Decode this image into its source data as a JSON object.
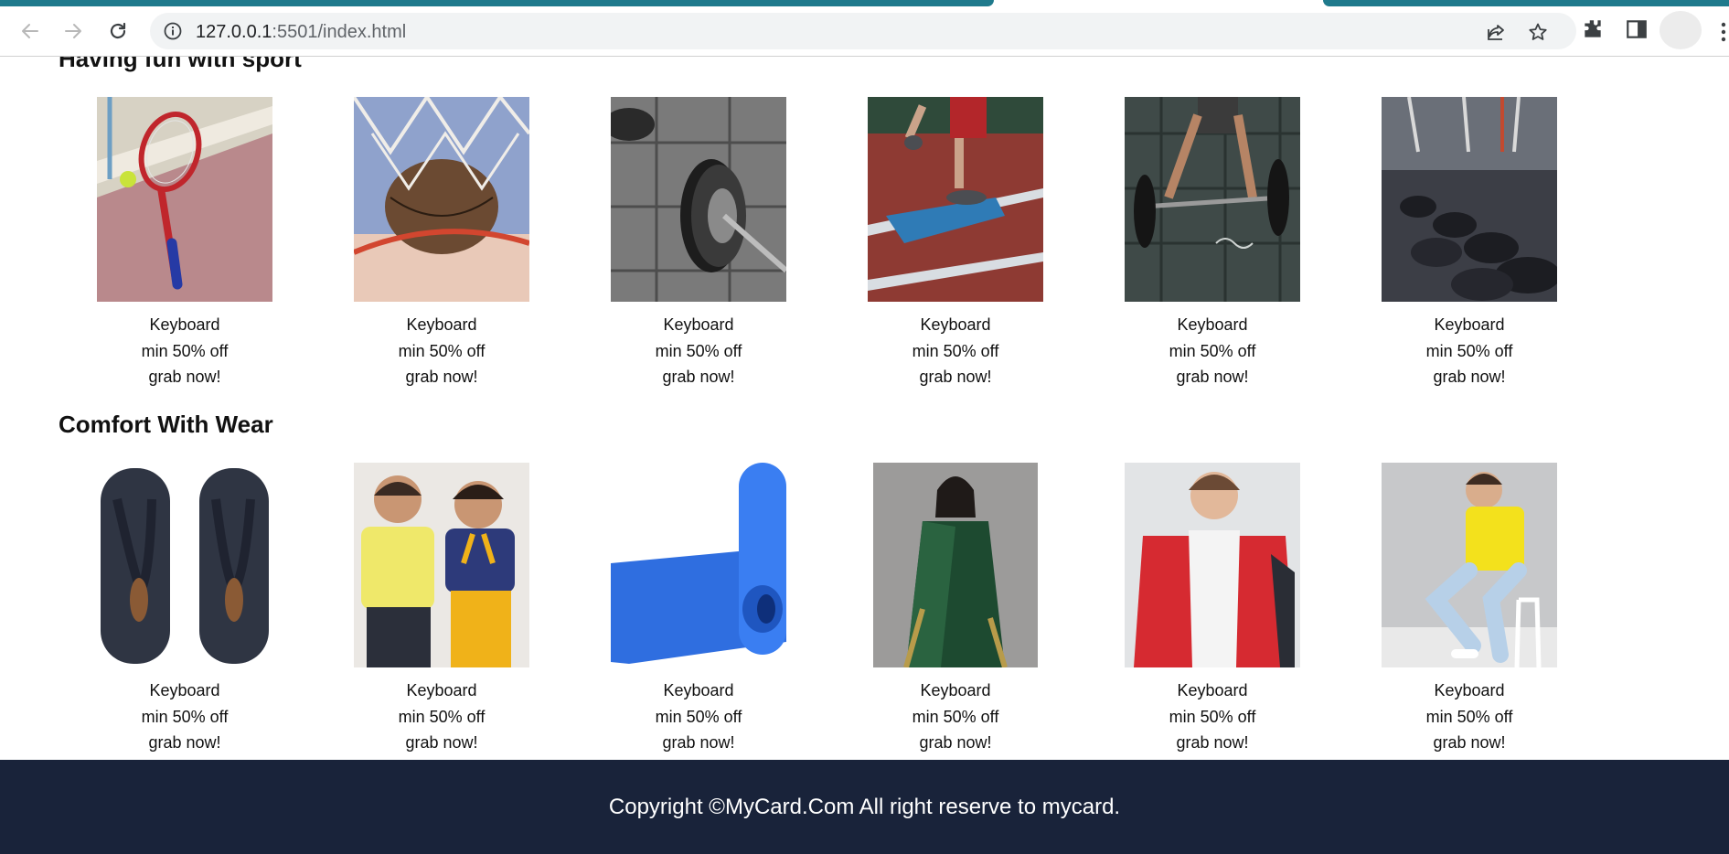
{
  "browser": {
    "url_host": "127.0.0.1",
    "url_rest": ":5501/index.html",
    "icons": [
      "back-icon",
      "forward-icon",
      "reload-icon",
      "info-icon",
      "share-icon",
      "star-icon",
      "extensions-icon",
      "side-panel-icon",
      "avatar",
      "menu-icon"
    ]
  },
  "sections": [
    {
      "title": "Having fun with sport",
      "products": [
        {
          "name": "Keyboard",
          "offer": "min 50% off",
          "cta": "grab now!",
          "image": "tennis-racket-photo"
        },
        {
          "name": "Keyboard",
          "offer": "min 50% off",
          "cta": "grab now!",
          "image": "basketball-hoop-photo"
        },
        {
          "name": "Keyboard",
          "offer": "min 50% off",
          "cta": "grab now!",
          "image": "barbell-plate-photo"
        },
        {
          "name": "Keyboard",
          "offer": "min 50% off",
          "cta": "grab now!",
          "image": "running-track-photo"
        },
        {
          "name": "Keyboard",
          "offer": "min 50% off",
          "cta": "grab now!",
          "image": "deadlift-photo"
        },
        {
          "name": "Keyboard",
          "offer": "min 50% off",
          "cta": "grab now!",
          "image": "dumbbell-rack-photo"
        }
      ]
    },
    {
      "title": "Comfort With Wear",
      "products": [
        {
          "name": "Keyboard",
          "offer": "min 50% off",
          "cta": "grab now!",
          "image": "flip-flops-photo"
        },
        {
          "name": "Keyboard",
          "offer": "min 50% off",
          "cta": "grab now!",
          "image": "kids-wear-photo"
        },
        {
          "name": "Keyboard",
          "offer": "min 50% off",
          "cta": "grab now!",
          "image": "yoga-mat-photo"
        },
        {
          "name": "Keyboard",
          "offer": "min 50% off",
          "cta": "grab now!",
          "image": "saree-photo"
        },
        {
          "name": "Keyboard",
          "offer": "min 50% off",
          "cta": "grab now!",
          "image": "red-jacket-photo"
        },
        {
          "name": "Keyboard",
          "offer": "min 50% off",
          "cta": "grab now!",
          "image": "yellow-tshirt-photo"
        }
      ]
    }
  ],
  "footer": {
    "text": "Copyright ©MyCard.Com All right reserve to mycard."
  },
  "colors": {
    "tab_accent": "#1f7a8c",
    "footer_bg": "#19233a",
    "omnibox_bg": "#f1f3f4"
  }
}
